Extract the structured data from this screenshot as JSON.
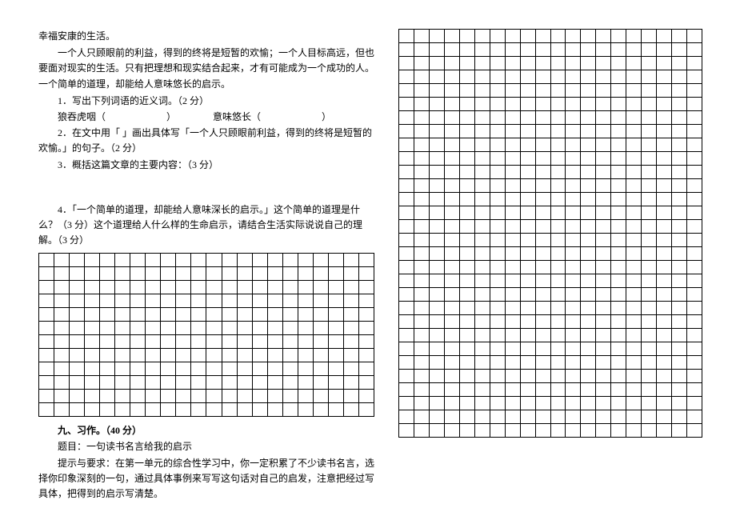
{
  "passage": {
    "line0": "幸福安康的生活。",
    "line1": "一个人只顾眼前的利益，得到的终将是短暂的欢愉；一个人目标高远，但也要面对现实的生活。只有把理想和现实结合起来，才有可能成为一个成功的人。一个简单的道理，却能给人意味悠长的启示。"
  },
  "q1": {
    "label": "1．写出下列词语的近义词。（2 分）",
    "word1_label": "狼吞虎咽（",
    "word1_close": "）",
    "word2_label": "意味悠长（",
    "word2_close": "）"
  },
  "q2": {
    "label": "2．在文中用「    」画出具体写「一个人只顾眼前利益，得到的终将是短暂的欢愉。」的句子。（2 分）"
  },
  "q3": {
    "label": "3．概括这篇文章的主要内容：（3 分）"
  },
  "q4": {
    "label": "4．「一个简单的道理，却能给人意味深长的启示。」这个简单的道理是什么？（3 分）这个道理给人什么样的生命启示，请结合生活实际说说自己的理解。（3 分）"
  },
  "section9": {
    "title": "九、习作。（40 分）",
    "topic_label": "题目：一句读书名言给我的启示",
    "prompt": "提示与要求：在第一单元的综合性学习中，你一定积累了不少读书名言，选择你印象深刻的一句，通过具体事例来写写这句话对自己的启发，注意把经过写具体，把得到的启示写清楚。"
  }
}
